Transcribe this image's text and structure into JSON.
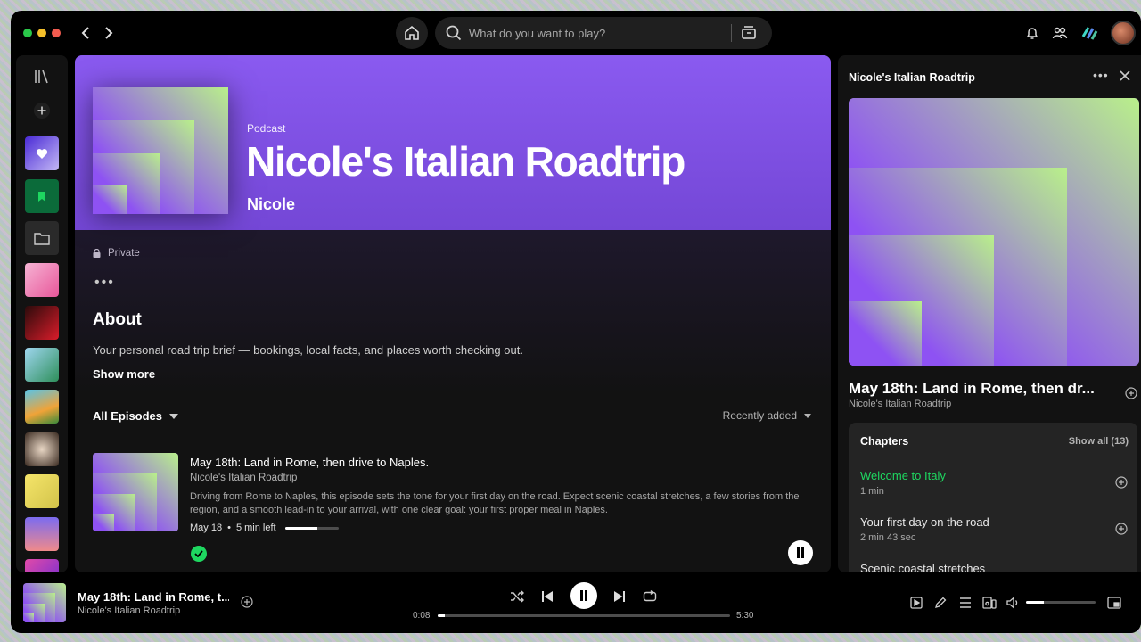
{
  "search": {
    "placeholder": "What do you want to play?"
  },
  "show": {
    "kind": "Podcast",
    "title": "Nicole's Italian Roadtrip",
    "author": "Nicole",
    "visibility": "Private",
    "about_heading": "About",
    "about_text": "Your personal road trip brief — bookings, local facts, and places worth checking out.",
    "show_more": "Show more"
  },
  "episodes_header": {
    "filter_label": "All Episodes",
    "sort_label": "Recently added"
  },
  "episodes": [
    {
      "title": "May 18th: Land in Rome, then drive to Naples.",
      "show": "Nicole's Italian Roadtrip",
      "description": "Driving from Rome to Naples, this episode sets the tone for your first day on the road. Expect scenic coastal stretches, a few stories from the region, and a smooth lead-in to your arrival, with one clear goal: your first proper meal in Naples.",
      "date": "May 18",
      "separator": "•",
      "time_left": "5 min left",
      "progress_fraction": 0.6
    }
  ],
  "right_panel": {
    "title": "Nicole's Italian Roadtrip",
    "episode_title": "May 18th: Land in Rome, then dr...",
    "episode_show": "Nicole's Italian Roadtrip",
    "chapters_heading": "Chapters",
    "show_all": "Show all (13)",
    "chapters": [
      {
        "name": "Welcome to Italy",
        "duration": "1 min",
        "active": true
      },
      {
        "name": "Your first day on the road",
        "duration": "2 min 43 sec",
        "active": false
      },
      {
        "name": "Scenic coastal stretches",
        "duration": "",
        "active": false
      }
    ]
  },
  "player": {
    "title": "May 18th: Land in Rome, t...",
    "show": "Nicole's Italian Roadtrip",
    "elapsed": "0:08",
    "total": "5:30",
    "progress_fraction": 0.025,
    "volume_fraction": 0.25
  },
  "colors": {
    "accent_green": "#1ed760",
    "hero_purple": "#8a5af0",
    "cover_lime": "#b9f08a",
    "cover_purple": "#8e52f3"
  },
  "icons": {
    "library": "library-icon",
    "add": "plus-icon",
    "liked": "heart-icon",
    "bookmarks": "bookmark-icon",
    "folder": "folder-icon",
    "search": "search-icon",
    "home": "home-icon",
    "browse": "browse-icon",
    "bell": "bell-icon",
    "friends": "friends-icon"
  }
}
